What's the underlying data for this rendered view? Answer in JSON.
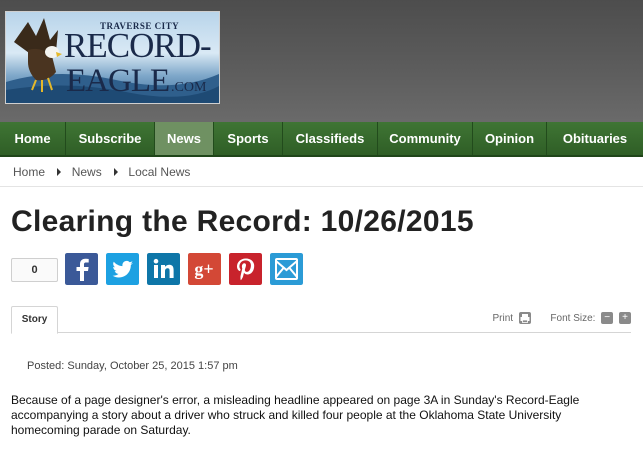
{
  "logo": {
    "small_text": "TRAVERSE CITY",
    "line1": "RECORD-",
    "line2": "EAGLE",
    "suffix": ".COM"
  },
  "nav": {
    "items": [
      {
        "label": "Home"
      },
      {
        "label": "Subscribe"
      },
      {
        "label": "News"
      },
      {
        "label": "Sports"
      },
      {
        "label": "Classifieds"
      },
      {
        "label": "Community"
      },
      {
        "label": "Opinion"
      },
      {
        "label": "Obituaries"
      }
    ],
    "active": "News"
  },
  "breadcrumb": [
    "Home",
    "News",
    "Local News"
  ],
  "article": {
    "title": "Clearing the Record: 10/26/2015",
    "share_count": "0",
    "tab_label": "Story",
    "print_label": "Print",
    "font_size_label": "Font Size:",
    "posted": "Posted: Sunday, October 25, 2015 1:57 pm",
    "body": "Because of a page designer's error, a misleading headline appeared on page 3A in Sunday's Record-Eagle accompanying a story about a driver who struck and killed four people at the Oklahoma State University homecoming parade on Saturday."
  },
  "share_buttons": [
    {
      "name": "facebook",
      "glyph": "f",
      "color": "#3b5998"
    },
    {
      "name": "twitter",
      "glyph": "t",
      "color": "#1da1e2"
    },
    {
      "name": "linkedin",
      "glyph": "in",
      "color": "#0e76a8"
    },
    {
      "name": "google-plus",
      "glyph": "g+",
      "color": "#d34836"
    },
    {
      "name": "pinterest",
      "glyph": "P",
      "color": "#c8232c"
    },
    {
      "name": "email",
      "glyph": "✉",
      "color": "#2b9bd6"
    }
  ],
  "colors": {
    "nav_green": "#2f5e26",
    "nav_active": "#6f9162",
    "header_gray": "#555555"
  }
}
